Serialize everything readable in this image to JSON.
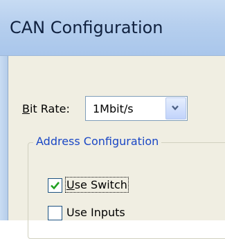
{
  "window": {
    "title": "CAN Configuration"
  },
  "bit_rate": {
    "label_mnemonic": "B",
    "label_rest": "it Rate:",
    "selected": "1Mbit/s"
  },
  "address_group": {
    "title": "Address Configuration",
    "options": [
      {
        "mnemonic": "U",
        "rest": "se Switch",
        "checked": true
      },
      {
        "mnemonic": "",
        "rest": "Use Inputs",
        "checked": false
      }
    ]
  },
  "colors": {
    "group_title": "#1a47c5",
    "checkmark": "#21a121"
  }
}
